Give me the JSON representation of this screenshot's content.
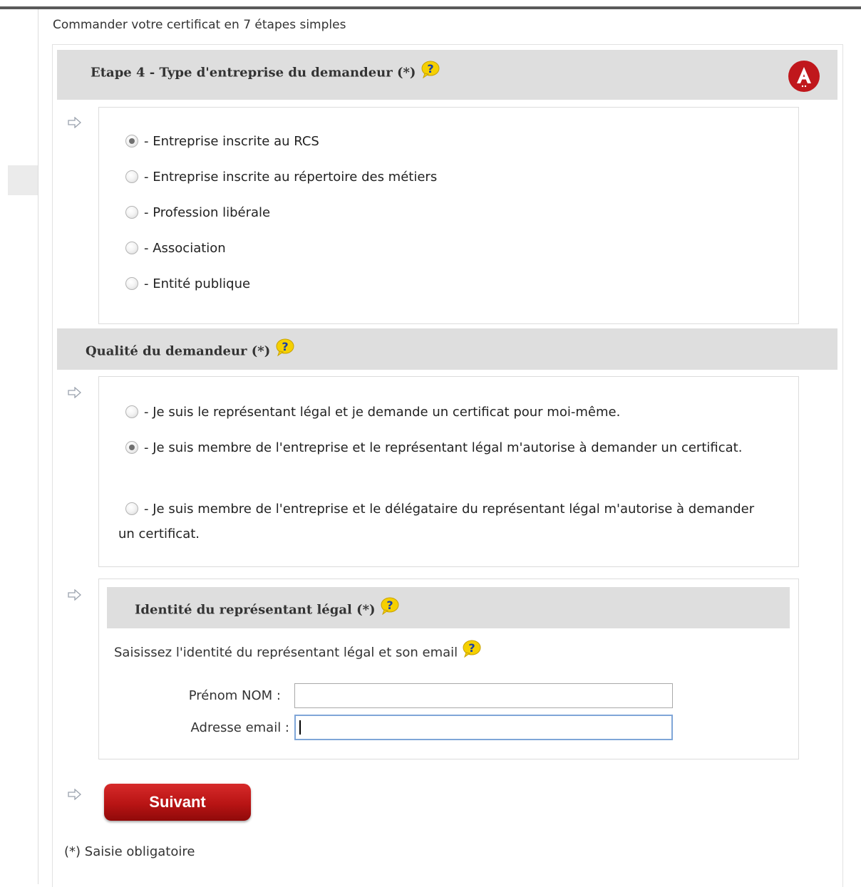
{
  "page": {
    "heading": "Commander votre certificat en 7 étapes simples"
  },
  "step": {
    "title": "Etape 4 - Type d'entreprise du demandeur (*)",
    "options": [
      {
        "label": "- Entreprise inscrite au RCS",
        "checked": true
      },
      {
        "label": "- Entreprise inscrite au répertoire des métiers",
        "checked": false
      },
      {
        "label": "- Profession libérale",
        "checked": false
      },
      {
        "label": "- Association",
        "checked": false
      },
      {
        "label": "- Entité publique",
        "checked": false
      }
    ]
  },
  "quality": {
    "title": "Qualité du demandeur (*)",
    "options": [
      {
        "label": "- Je suis le représentant légal et je demande un certificat pour moi-même.",
        "checked": false
      },
      {
        "label": "- Je suis membre de l'entreprise et le représentant légal m'autorise à demander un certificat.",
        "checked": true
      },
      {
        "label": "- Je suis membre de l'entreprise et le délégataire du représentant légal m'autorise à demander un certificat.",
        "checked": false
      }
    ]
  },
  "identity": {
    "title": "Identité du représentant légal (*)",
    "instruction": "Saisissez l'identité du représentant légal et son email",
    "name_label": "Prénom NOM :",
    "name_value": "",
    "email_label": "Adresse email :",
    "email_value": ""
  },
  "actions": {
    "next_label": "Suivant"
  },
  "footer": {
    "required_note": "(*) Saisie obligatoire"
  },
  "icons": {
    "help": "help-question-icon",
    "arrow": "arrow-right-outline-icon",
    "logo": "brand-logo-icon"
  },
  "colors": {
    "primary_red": "#c0171c",
    "section_bar": "#dedede",
    "help_yellow": "#f5d000",
    "help_blue": "#1a3fa8"
  }
}
